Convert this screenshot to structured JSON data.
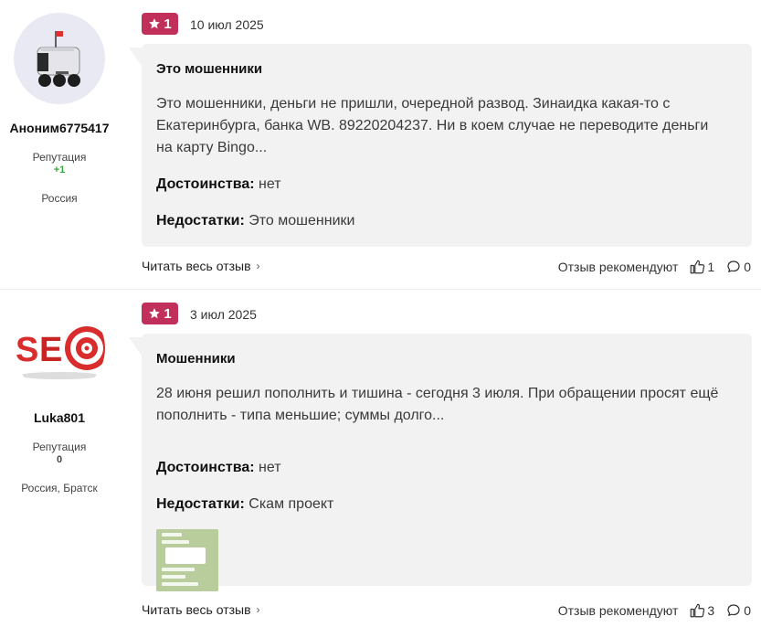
{
  "reviews": [
    {
      "author": {
        "name": "Аноним6775417",
        "avatar_icon": "robot-avatar-icon",
        "reputation_label": "Репутация",
        "reputation_value": "+1",
        "location": "Россия"
      },
      "rating": "1",
      "date": "10 июл 2025",
      "title": "Это мошенники",
      "text": "Это мошенники, деньги не пришли, очередной развод. Зинаидка какая-то с Екатеринбурга, банка WB. 89220204237. Ни в коем случае не переводите деньги на карту Bingo...",
      "pros_label": "Достоинства:",
      "pros": "нет",
      "cons_label": "Недостатки:",
      "cons": "Это мошенники",
      "read_more": "Читать весь отзыв",
      "recommend_label": "Отзыв рекомендуют",
      "likes": "1",
      "comments": "0"
    },
    {
      "author": {
        "name": "Luka801",
        "avatar_icon": "seo-avatar-icon",
        "reputation_label": "Репутация",
        "reputation_value": "0",
        "location": "Россия, Братск"
      },
      "rating": "1",
      "date": "3 июл 2025",
      "title": "Мошенники",
      "text": "28 июня решил пополнить и тишина - сегодня 3 июля. При обращении просят ещё пополнить - типа меньшие; суммы долго...",
      "pros_label": "Достоинства:",
      "pros": "нет",
      "cons_label": "Недостатки:",
      "cons": "Скам проект",
      "attachment_icon": "chat-screenshot-thumbnail",
      "read_more": "Читать весь отзыв",
      "recommend_label": "Отзыв рекомендуют",
      "likes": "3",
      "comments": "0"
    }
  ],
  "colors": {
    "badge": "#c0305a",
    "bubble": "#f2f2f3",
    "positive": "#3aa53d"
  }
}
